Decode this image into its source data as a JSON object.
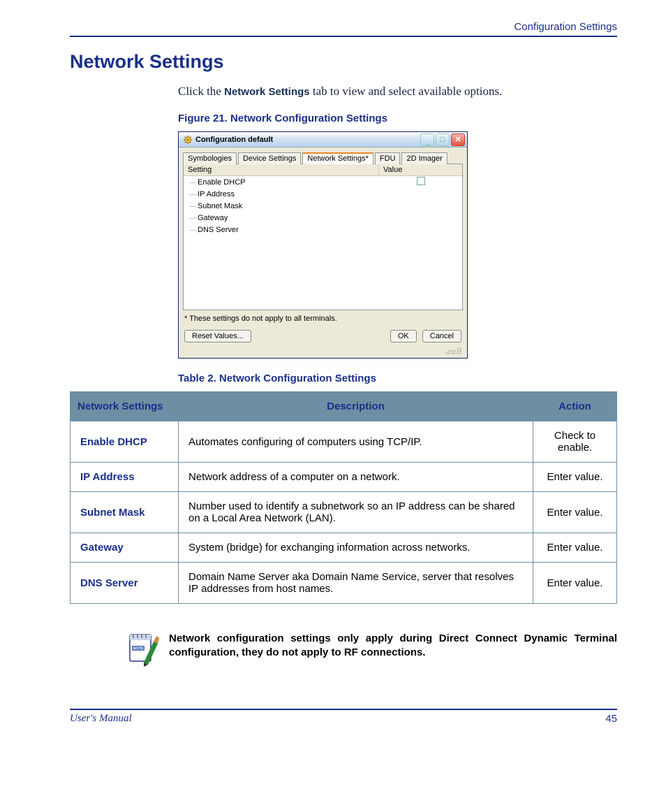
{
  "header": {
    "breadcrumb": "Configuration Settings"
  },
  "title": "Network Settings",
  "intro": {
    "prefix": "Click the ",
    "bold": "Network Settings",
    "suffix": " tab to view and select available options."
  },
  "figure": {
    "caption": "Figure 21. Network Configuration Settings"
  },
  "dialog": {
    "title": "Configuration default",
    "tabs": [
      "Symbologies",
      "Device Settings",
      "Network Settings*",
      "FDU",
      "2D Imager"
    ],
    "active_tab_index": 2,
    "columns": {
      "setting": "Setting",
      "value": "Value"
    },
    "rows": [
      {
        "label": "Enable DHCP",
        "has_checkbox": true
      },
      {
        "label": "IP Address",
        "has_checkbox": false
      },
      {
        "label": "Subnet Mask",
        "has_checkbox": false
      },
      {
        "label": "Gateway",
        "has_checkbox": false
      },
      {
        "label": "DNS Server",
        "has_checkbox": false
      }
    ],
    "footnote": "* These settings do not apply to all terminals.",
    "buttons": {
      "reset": "Reset Values...",
      "ok": "OK",
      "cancel": "Cancel"
    }
  },
  "table": {
    "caption": "Table 2. Network Configuration Settings",
    "headers": {
      "setting": "Network Settings",
      "description": "Description",
      "action": "Action"
    },
    "rows": [
      {
        "setting": "Enable DHCP",
        "description": "Automates configuring of computers using TCP/IP.",
        "action": "Check to enable."
      },
      {
        "setting": "IP Address",
        "description": "Network address of a computer on a network.",
        "action": "Enter value."
      },
      {
        "setting": "Subnet Mask",
        "description": "Number used to identify a subnetwork so an IP address can be shared on a Local Area Network (LAN).",
        "action": "Enter value."
      },
      {
        "setting": "Gateway",
        "description": "System (bridge) for exchanging information across networks.",
        "action": "Enter value."
      },
      {
        "setting": "DNS Server",
        "description": "Domain Name Server aka Domain Name Service, server that resolves IP addresses from host names.",
        "action": "Enter value."
      }
    ]
  },
  "note": {
    "badge": "NOTE",
    "text": "Network configuration settings only apply during Direct Connect Dynamic Terminal configuration, they do not apply to RF connections."
  },
  "footer": {
    "left": "User's Manual",
    "page": "45"
  }
}
